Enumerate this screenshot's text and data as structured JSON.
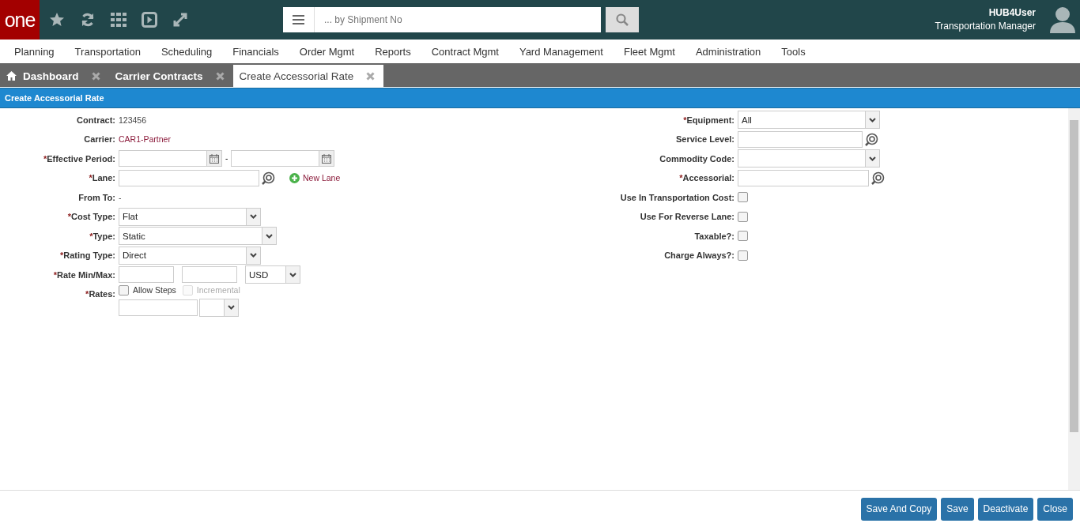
{
  "header": {
    "logo": "one",
    "search": {
      "placeholder": "... by Shipment No"
    },
    "user": {
      "name": "HUB4User",
      "role": "Transportation Manager"
    }
  },
  "menu": [
    "Planning",
    "Transportation",
    "Scheduling",
    "Financials",
    "Order Mgmt",
    "Reports",
    "Contract Mgmt",
    "Yard Management",
    "Fleet Mgmt",
    "Administration",
    "Tools"
  ],
  "tabs": [
    {
      "label": "Dashboard",
      "selected": false,
      "home": true
    },
    {
      "label": "Carrier Contracts",
      "selected": false,
      "home": false
    },
    {
      "label": "Create Accessorial Rate",
      "selected": true,
      "home": false
    }
  ],
  "panel_title": "Create Accessorial Rate",
  "required_mark": "*",
  "left_fields": [
    {
      "kind": "text",
      "label": "Contract:",
      "required": false,
      "value": "123456"
    },
    {
      "kind": "link",
      "label": "Carrier:",
      "required": false,
      "value": "CAR1-Partner"
    },
    {
      "kind": "date_range",
      "label": "Effective Period:",
      "required": true,
      "separator": "-"
    },
    {
      "kind": "lookup",
      "label": "Lane:",
      "required": true,
      "action": "New Lane"
    },
    {
      "kind": "text",
      "label": "From To:",
      "required": false,
      "value": "-"
    },
    {
      "kind": "select",
      "label": "Cost Type:",
      "required": true,
      "value": "Flat"
    },
    {
      "kind": "select",
      "label": "Type:",
      "required": true,
      "value": "Static"
    },
    {
      "kind": "select",
      "label": "Rating Type:",
      "required": true,
      "value": "Direct"
    },
    {
      "kind": "min_max",
      "label": "Rate Min/Max:",
      "required": true,
      "currency": "USD"
    },
    {
      "kind": "rates",
      "label": "Rates:",
      "required": true,
      "options": [
        {
          "label": "Allow Steps",
          "checked": false,
          "disabled": false
        },
        {
          "label": "Incremental",
          "checked": false,
          "disabled": true
        }
      ]
    }
  ],
  "right_fields": [
    {
      "kind": "select",
      "label": "Equipment:",
      "required": true,
      "value": "All"
    },
    {
      "kind": "lookup",
      "label": "Service Level:",
      "required": false
    },
    {
      "kind": "select",
      "label": "Commodity Code:",
      "required": false
    },
    {
      "kind": "lookup",
      "label": "Accessorial:",
      "required": true
    },
    {
      "kind": "checkbox",
      "label": "Use In Transportation Cost:",
      "required": false,
      "checked": false
    },
    {
      "kind": "checkbox",
      "label": "Use For Reverse Lane:",
      "required": false,
      "checked": false
    },
    {
      "kind": "checkbox",
      "label": "Taxable?:",
      "required": false,
      "checked": false
    },
    {
      "kind": "checkbox",
      "label": "Charge Always?:",
      "required": false,
      "checked": false
    }
  ],
  "buttons": [
    "Save And Copy",
    "Save",
    "Deactivate",
    "Close"
  ]
}
